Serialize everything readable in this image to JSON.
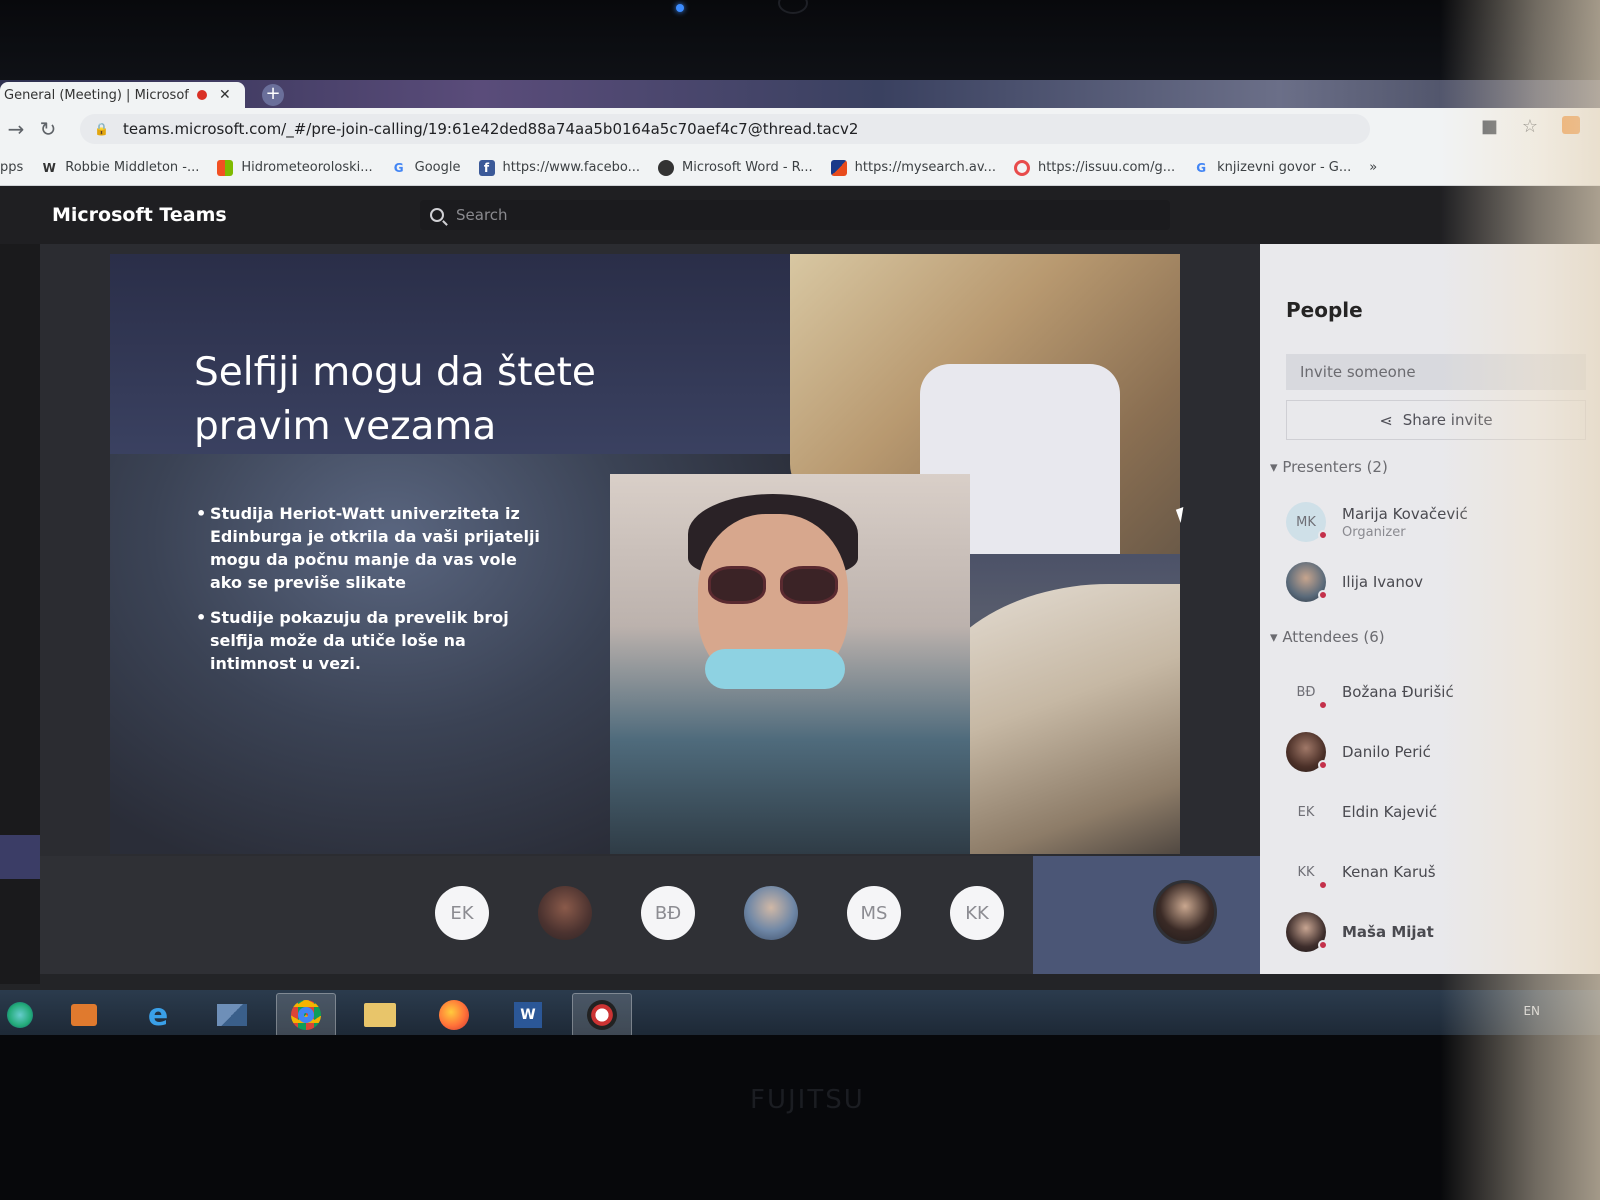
{
  "browser": {
    "tab_title": "General (Meeting) | Microsof",
    "new_tab_label": "+",
    "close_label": "✕",
    "url": "teams.microsoft.com/_#/pre-join-calling/19:61e42ded88a74aa5b0164a5c70aef4c7@thread.tacv2",
    "bookmarks": [
      {
        "label": "pps",
        "icon": "apps-icon"
      },
      {
        "label": "Robbie Middleton -...",
        "icon": "w-icon"
      },
      {
        "label": "Hidrometeoroloski...",
        "icon": "windows-icon"
      },
      {
        "label": "Google",
        "icon": "google-icon"
      },
      {
        "label": "https://www.facebo...",
        "icon": "facebook-icon"
      },
      {
        "label": "Microsoft Word - R...",
        "icon": "globe-icon"
      },
      {
        "label": "https://mysearch.av...",
        "icon": "avast-icon"
      },
      {
        "label": "https://issuu.com/g...",
        "icon": "issuu-icon"
      },
      {
        "label": "knjizevni govor - G...",
        "icon": "google-icon"
      }
    ],
    "more_bookmarks": "»"
  },
  "teams": {
    "app_title": "Microsoft Teams",
    "search_placeholder": "Search"
  },
  "slide": {
    "title": "Selfiji mogu da štete pravim vezama",
    "bullets": [
      "Studija Heriot-Watt univerziteta iz Edinburga je otkrila da vaši prijatelji mogu da počnu manje da vas vole ako se previše slikate",
      "Studije pokazuju da prevelik broj selfija može da utiče loše na intimnost u vezi."
    ]
  },
  "participants_strip": [
    {
      "initials": "EK",
      "type": "initials"
    },
    {
      "initials": "",
      "type": "photo1"
    },
    {
      "initials": "BĐ",
      "type": "initials"
    },
    {
      "initials": "",
      "type": "photo2"
    },
    {
      "initials": "MS",
      "type": "initials"
    },
    {
      "initials": "KK",
      "type": "initials"
    }
  ],
  "people_panel": {
    "title": "People",
    "invite_placeholder": "Invite someone",
    "share_label": "Share invite",
    "presenters_header": "Presenters (2)",
    "attendees_header": "Attendees (6)",
    "presenters": [
      {
        "initials": "MK",
        "name": "Marija Kovačević",
        "role": "Organizer",
        "avatar": "init"
      },
      {
        "initials": "",
        "name": "Ilija Ivanov",
        "role": "",
        "avatar": "ph1"
      }
    ],
    "attendees": [
      {
        "initials": "BĐ",
        "name": "Božana Đurišić",
        "avatar": "plain"
      },
      {
        "initials": "",
        "name": "Danilo Perić",
        "avatar": "ph2"
      },
      {
        "initials": "EK",
        "name": "Eldin Kajević",
        "avatar": "plain"
      },
      {
        "initials": "KK",
        "name": "Kenan Karuš",
        "avatar": "plain"
      },
      {
        "initials": "",
        "name": "Maša Mijat",
        "avatar": "ph3"
      }
    ]
  },
  "taskbar": {
    "items": [
      "start-icon",
      "media-player-icon",
      "internet-explorer-icon",
      "outlook-icon",
      "chrome-icon",
      "file-explorer-icon",
      "firefox-icon",
      "word-icon",
      "app-icon"
    ],
    "tray_language": "EN"
  },
  "colors": {
    "teams_header": "#1f1f22",
    "presence_busy": "#c4314b",
    "self_tile": "#4b5676"
  }
}
